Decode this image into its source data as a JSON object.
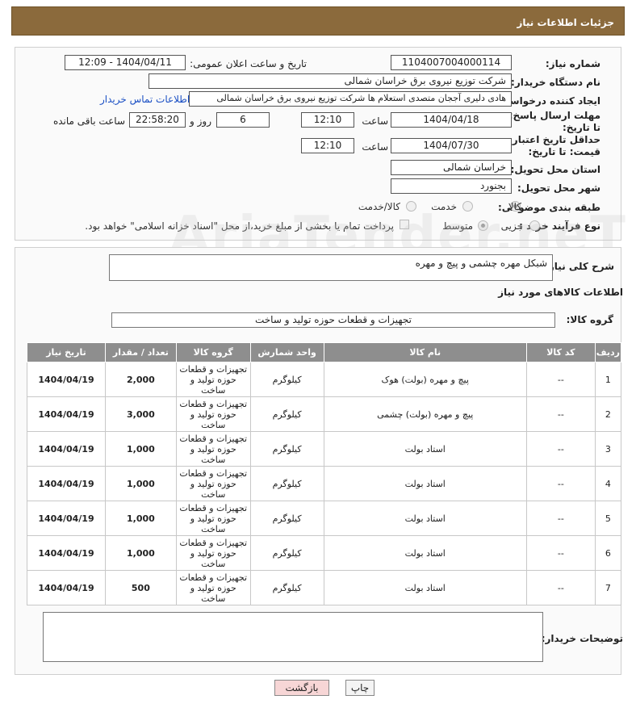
{
  "header": {
    "title": "جزئیات اطلاعات نیاز"
  },
  "form": {
    "need_number_label": "شماره نیاز:",
    "need_number": "1104007004000114",
    "announce_label": "تاریخ و ساعت اعلان عمومی:",
    "announce_value": "1404/04/11 - 12:09",
    "buyer_org_label": "نام دستگاه خریدار:",
    "buyer_org": "شرکت توزیع نیروی برق خراسان شمالی",
    "requester_label": "ایجاد کننده درخواست:",
    "requester": "هادی دلیری آججان متصدی استعلام ها شرکت توزیع نیروی برق خراسان شمالی",
    "contact_link": "اطلاعات تماس خریدار",
    "reply_deadline_label": "مهلت ارسال پاسخ: تا تاریخ:",
    "reply_date": "1404/04/18",
    "time_label": "ساعت",
    "reply_time": "12:10",
    "days_value": "6",
    "days_label": "روز و",
    "remaining_time": "22:58:20",
    "remaining_label": "ساعت باقی مانده",
    "price_deadline_label": "حداقل تاریخ اعتبار قیمت: تا تاریخ:",
    "price_date": "1404/07/30",
    "price_time": "12:10",
    "province_label": "استان محل تحویل:",
    "province": "خراسان شمالی",
    "city_label": "شهر محل تحویل:",
    "city": "بجنورد",
    "category_label": "طبقه بندی موضوعی:",
    "category_options": [
      "کالا",
      "خدمت",
      "کالا/خدمت"
    ],
    "process_label": "نوع فرآیند خرید :",
    "process_options": [
      "جزیی",
      "متوسط"
    ],
    "payment_note": "پرداخت تمام یا بخشی از مبلغ خرید،از محل \"اسناد خزانه اسلامی\" خواهد بود."
  },
  "details": {
    "summary_label": "شرح کلی نیاز:",
    "summary": "شبکل مهره چشمی و پیچ و مهره",
    "goods_info_title": "اطلاعات کالاهای مورد نیاز",
    "goods_group_label": "گروه کالا:",
    "goods_group": "تجهیزات و قطعات حوزه تولید و ساخت"
  },
  "table": {
    "headers": [
      "ردیف",
      "کد کالا",
      "نام کالا",
      "واحد شمارش",
      "گروه کالا",
      "تعداد / مقدار",
      "تاریخ نیاز"
    ],
    "rows": [
      {
        "row": "1",
        "code": "--",
        "name": "پیچ و مهره (بولت) هوک",
        "unit": "کیلوگرم",
        "group": "تجهیزات و قطعات حوزه تولید و ساخت",
        "qty": "2,000",
        "date": "1404/04/19"
      },
      {
        "row": "2",
        "code": "--",
        "name": "پیچ و مهره (بولت) چشمی",
        "unit": "کیلوگرم",
        "group": "تجهیزات و قطعات حوزه تولید و ساخت",
        "qty": "3,000",
        "date": "1404/04/19"
      },
      {
        "row": "3",
        "code": "--",
        "name": "استاد بولت",
        "unit": "کیلوگرم",
        "group": "تجهیزات و قطعات حوزه تولید و ساخت",
        "qty": "1,000",
        "date": "1404/04/19"
      },
      {
        "row": "4",
        "code": "--",
        "name": "استاد بولت",
        "unit": "کیلوگرم",
        "group": "تجهیزات و قطعات حوزه تولید و ساخت",
        "qty": "1,000",
        "date": "1404/04/19"
      },
      {
        "row": "5",
        "code": "--",
        "name": "استاد بولت",
        "unit": "کیلوگرم",
        "group": "تجهیزات و قطعات حوزه تولید و ساخت",
        "qty": "1,000",
        "date": "1404/04/19"
      },
      {
        "row": "6",
        "code": "--",
        "name": "استاد بولت",
        "unit": "کیلوگرم",
        "group": "تجهیزات و قطعات حوزه تولید و ساخت",
        "qty": "1,000",
        "date": "1404/04/19"
      },
      {
        "row": "7",
        "code": "--",
        "name": "استاد بولت",
        "unit": "کیلوگرم",
        "group": "تجهیزات و قطعات حوزه تولید و ساخت",
        "qty": "500",
        "date": "1404/04/19"
      }
    ]
  },
  "buyer_notes_label": "توضیحات خریدار:",
  "buttons": {
    "print": "چاپ",
    "back": "بازگشت"
  },
  "watermark": "AriaTender.neT",
  "colors": {
    "header_bg": "#8b6a3c",
    "table_header_bg": "#8e8e8e",
    "link": "#1a4fc4",
    "back_button_bg": "#f7d6d6"
  }
}
